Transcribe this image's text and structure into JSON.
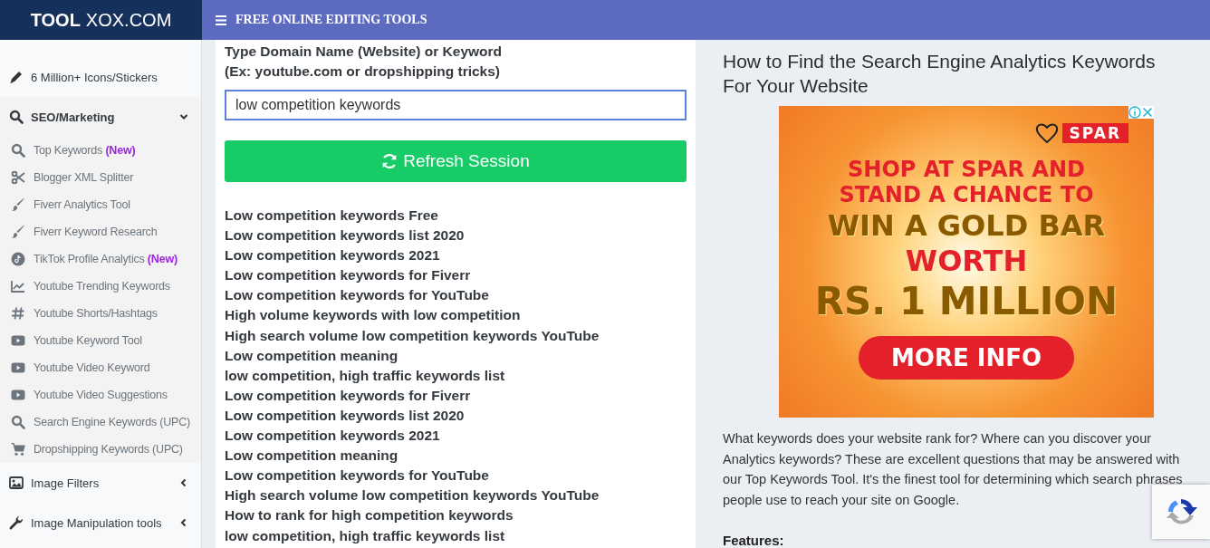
{
  "header": {
    "brand_bold": "TOOL",
    "brand_rest": "XOX.COM",
    "title": "FREE ONLINE EDITING TOOLS"
  },
  "sidebar": {
    "items": [
      {
        "kind": "pencil",
        "label": "6 Million+ Icons/Stickers"
      },
      {
        "kind": "search",
        "label": "SEO/Marketing",
        "expanded": true,
        "children": [
          {
            "kind": "search",
            "label": "Top Keywords",
            "badge": "(New)"
          },
          {
            "kind": "scissors",
            "label": "Blogger XML Splitter"
          },
          {
            "kind": "brush",
            "label": "Fiverr Analytics Tool"
          },
          {
            "kind": "brush",
            "label": "Fiverr Keyword Research"
          },
          {
            "kind": "tiktok",
            "label": "TikTok Profile Analytics",
            "badge": "(New)"
          },
          {
            "kind": "chart",
            "label": "Youtube Trending Keywords"
          },
          {
            "kind": "hash",
            "label": "Youtube Shorts/Hashtags"
          },
          {
            "kind": "video",
            "label": "Youtube Keyword Tool"
          },
          {
            "kind": "video",
            "label": "Youtube Video Keyword"
          },
          {
            "kind": "video",
            "label": "Youtube Video Suggestions"
          },
          {
            "kind": "search",
            "label": "Search Engine Keywords (UPC)"
          },
          {
            "kind": "cart",
            "label": "Dropshipping Keywords (UPC)"
          }
        ]
      },
      {
        "kind": "image",
        "label": "Image Filters",
        "expanded": false
      },
      {
        "kind": "wrench",
        "label": "Image Manipulation tools",
        "expanded": false
      }
    ]
  },
  "main": {
    "prompt": [
      "Type Domain Name (Website) or Keyword",
      "(Ex: youtube.com or dropshipping tricks)"
    ],
    "search_value": "low competition keywords",
    "button": "Refresh Session",
    "results": [
      "Low competition keywords Free",
      "Low competition keywords list 2020",
      "Low competition keywords 2021",
      "Low competition keywords for Fiverr",
      "Low competition keywords for YouTube",
      "High volume keywords with low competition",
      "High search volume low competition keywords YouTube",
      "Low competition meaning",
      "low competition, high traffic keywords list",
      "Low competition keywords for Fiverr",
      "Low competition keywords list 2020",
      "Low competition keywords 2021",
      "Low competition meaning",
      "Low competition keywords for YouTube",
      "High search volume low competition keywords YouTube",
      "How to rank for high competition keywords",
      "low competition, high traffic keywords list"
    ]
  },
  "aside": {
    "title": "How to Find the Search Engine Analytics Keywords For Your Website",
    "ad": {
      "brand": "SPAR",
      "headline": [
        "SHOP AT SPAR AND",
        "STAND A CHANCE TO"
      ],
      "prize": "WIN A GOLD BAR",
      "worth": "WORTH",
      "amount": "RS. 1 MILLION",
      "cta": "MORE INFO"
    },
    "paragraph": "What keywords does your website rank for? Where can you discover your Analytics keywords? These are excellent questions that may be answered with our Top Keywords Tool. It's the finest tool for determining which search phrases people use to reach your site on Google.",
    "features_heading": "Features:"
  }
}
